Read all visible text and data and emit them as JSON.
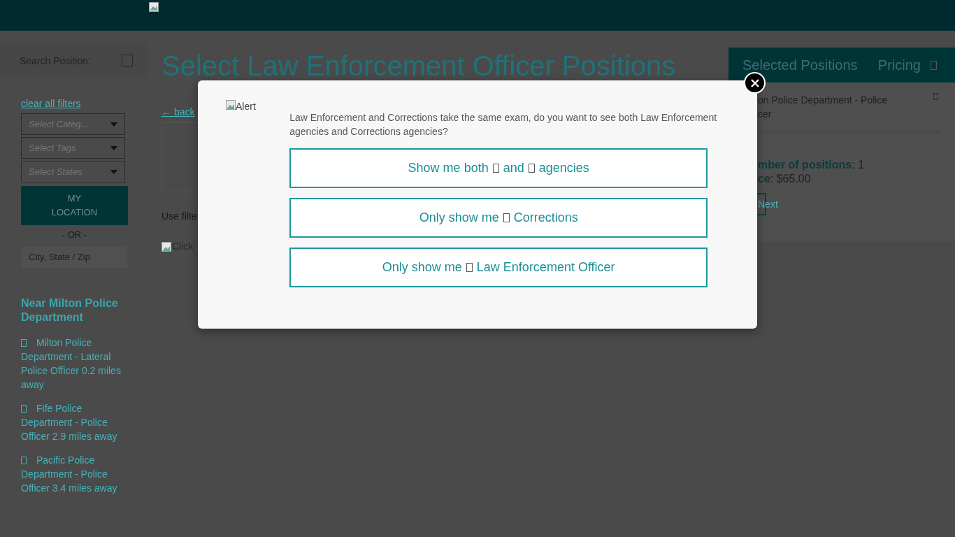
{
  "sidebar": {
    "search_label": "Search Position:",
    "clear_filters": "clear all filters",
    "selects": [
      {
        "placeholder": "Select Categ..."
      },
      {
        "placeholder": "Select Tags"
      },
      {
        "placeholder": "Select States"
      }
    ],
    "location_button": "MY LOCATION",
    "or_text": "- OR -",
    "city_placeholder": "City, State / Zip",
    "nearby_title": "Near Milton Police Department",
    "nearby": [
      {
        "label": "Milton Police Department - Lateral Police Officer 0.2 miles away"
      },
      {
        "label": "Fife Police Department - Police Officer 2.9 miles away"
      },
      {
        "label": "Pacific Police Department - Police Officer 3.4 miles away"
      }
    ]
  },
  "main": {
    "title": "Select Law Enforcement Officer Positions",
    "back_link": "← back",
    "filter_hint": "Use filte",
    "image_alt": "Click"
  },
  "selected_panel": {
    "title": "Selected Positions",
    "pricing": "Pricing",
    "position_lines": [
      "on Police Department - Police",
      "cer"
    ],
    "count_line": "**mber of positions**: 1",
    "price_line": "**ce**: $65.00",
    "next": "Next"
  },
  "modal": {
    "image_alt": "Alert",
    "message": "Law Enforcement and Corrections take the same exam, do you want to see both Law Enforcement agencies and Corrections agencies?",
    "options": [
      {
        "parts": [
          "Show me both",
          "and",
          "agencies"
        ]
      },
      {
        "parts": [
          "Only show me",
          "Corrections"
        ]
      },
      {
        "parts": [
          "Only show me",
          "Law Enforcement Officer"
        ]
      }
    ]
  }
}
